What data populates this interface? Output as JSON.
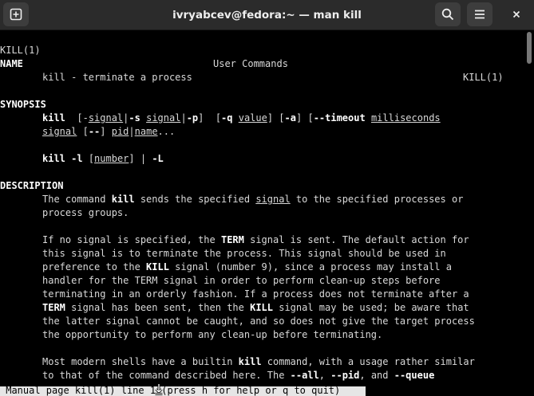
{
  "window": {
    "title": "ivryabcev@fedora:~ — man kill",
    "new_tab_icon": "new-tab-icon",
    "search_icon": "search-icon",
    "menu_icon": "hamburger-menu-icon",
    "close_icon": "close-icon"
  },
  "man": {
    "header_left": "KILL(1)",
    "header_center": "User Commands",
    "header_right": "KILL(1)",
    "name_heading": "NAME",
    "name_text": "kill - terminate a process",
    "synopsis_heading": "SYNOPSIS",
    "syn1": {
      "cmd": "kill",
      "p1": "  [-",
      "signal1": "signal",
      "p2": "|",
      "s_flag": "-s",
      "p3": " ",
      "signal2": "signal",
      "p4": "|",
      "p_flag": "-p",
      "p5": "]  [",
      "q_flag": "-q",
      "p6": " ",
      "value": "value",
      "p7": "] [",
      "a_flag": "-a",
      "p8": "] [",
      "timeout_flag": "--timeout",
      "p9": " ",
      "milliseconds": "milliseconds"
    },
    "syn2": {
      "signal": "signal",
      "p1": " [",
      "dd": "--",
      "p2": "] ",
      "pid": "pid",
      "p3": "|",
      "name": "name",
      "p4": "..."
    },
    "syn3": {
      "cmd": "kill",
      "p1": " ",
      "l_flag": "-l",
      "p2": " [",
      "number": "number",
      "p3": "] | ",
      "L_flag": "-L"
    },
    "description_heading": "DESCRIPTION",
    "d1a": {
      "t1": "The command ",
      "kill": "kill",
      "t2": " sends the specified ",
      "signal": "signal",
      "t3": " to the specified processes or"
    },
    "d1b": "process groups.",
    "d2a": {
      "t1": "If no signal is specified, the ",
      "term": "TERM",
      "t2": " signal is sent. The default action for"
    },
    "d2b": "this signal is to terminate the process. This signal should be used in",
    "d2c": {
      "t1": "preference to the ",
      "kill": "KILL",
      "t2": " signal (number 9), since a process may install a"
    },
    "d2d": "handler for the TERM signal in order to perform clean-up steps before",
    "d2e": "terminating in an orderly fashion. If a process does not terminate after a",
    "d2f": {
      "term": "TERM",
      "t1": " signal has been sent, then the ",
      "kill": "KILL",
      "t2": " signal may be used; be aware that"
    },
    "d2g": "the latter signal cannot be caught, and so does not give the target process",
    "d2h": "the opportunity to perform any clean-up before terminating.",
    "d3a": {
      "t1": "Most modern shells have a builtin ",
      "kill": "kill",
      "t2": " command, with a usage rather similar"
    },
    "d3b": {
      "t1": "to that of the command described here. The ",
      "all": "--all",
      "t2": ", ",
      "pid": "--pid",
      "t3": ", and ",
      "queue": "--queue"
    }
  },
  "status": {
    "text": " Manual page kill(1) line 1 (press h for help or q to quit)"
  },
  "colors": {
    "background": "#000000",
    "foreground": "#d9d9d9",
    "titlebar": "#2b2b2b",
    "status_bg": "#e6e6e6"
  }
}
